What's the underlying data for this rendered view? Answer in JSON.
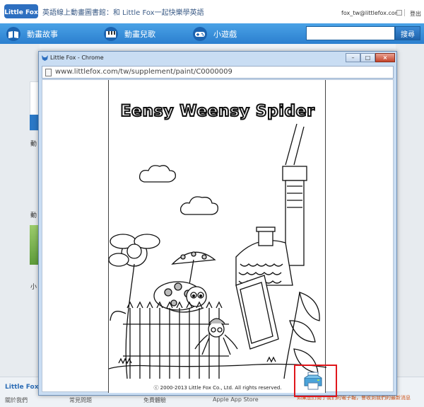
{
  "header": {
    "logo_text": "Little Fox",
    "tagline": "英語線上動畫圖書館：和 Little Fox一起快樂學英語",
    "account_email": "fox_tw@littlefox.com",
    "logout_label": "登出"
  },
  "nav": {
    "items": [
      {
        "label": "動畫故事",
        "icon": "book-icon"
      },
      {
        "label": "動畫兒歌",
        "icon": "piano-icon"
      },
      {
        "label": "小遊戲",
        "icon": "gamepad-icon"
      }
    ],
    "search": {
      "placeholder": "",
      "button_label": "搜尋"
    }
  },
  "background": {
    "side_texts": [
      "動",
      "動",
      "小"
    ],
    "footer_brand": "Little Fox",
    "footer_links": [
      "關於我們",
      "常見問題",
      "免費體驗",
      "Apple App Store"
    ],
    "footer_note": "如果您訂閱了我們的電子報，會收到我們的最新消息"
  },
  "popup": {
    "window_title": "Little Fox - Chrome",
    "url": "www.littlefox.com/tw/supplement/paint/C0000009",
    "sheet_title": "Eensy Weensy Spider",
    "copyright": "ⓒ 2000-2013 Little Fox Co., Ltd. All rights reserved.",
    "print_icon": "printer-icon"
  },
  "colors": {
    "nav_blue": "#2b7fcf",
    "highlight_red": "#e0161b",
    "window_frame": "#c9ddf3"
  }
}
